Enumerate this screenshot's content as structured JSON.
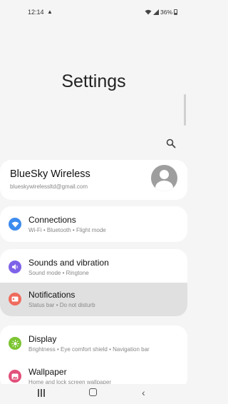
{
  "status_bar": {
    "time": "12:14",
    "battery": "36%"
  },
  "page": {
    "title": "Settings"
  },
  "account": {
    "name": "BlueSky Wireless",
    "email": "blueskywirelessltd@gmail.com"
  },
  "items": [
    {
      "title": "Connections",
      "subtitle": "Wi-Fi  •  Bluetooth  •  Flight mode",
      "icon": "wifi-icon",
      "color": "#3d8bef"
    },
    {
      "title": "Sounds and vibration",
      "subtitle": "Sound mode  •  Ringtone",
      "icon": "speaker-icon",
      "color": "#7e62e8"
    },
    {
      "title": "Notifications",
      "subtitle": "Status bar  •  Do not disturb",
      "icon": "notification-icon",
      "color": "#ef6b5d"
    },
    {
      "title": "Display",
      "subtitle": "Brightness  •  Eye comfort shield  •  Navigation bar",
      "icon": "sun-icon",
      "color": "#7cc532"
    },
    {
      "title": "Wallpaper",
      "subtitle": "Home and lock screen wallpaper",
      "icon": "image-icon",
      "color": "#e2507a"
    }
  ]
}
